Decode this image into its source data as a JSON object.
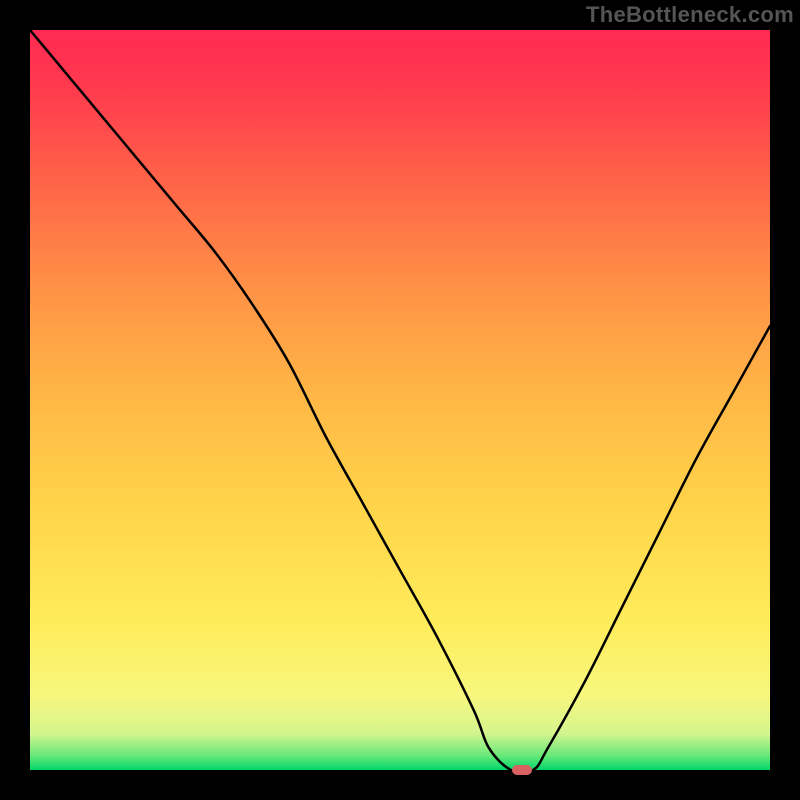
{
  "watermark": "TheBottleneck.com",
  "chart_data": {
    "type": "line",
    "title": "",
    "xlabel": "",
    "ylabel": "",
    "xlim": [
      0,
      100
    ],
    "ylim": [
      0,
      100
    ],
    "x": [
      0,
      5,
      10,
      15,
      20,
      25,
      30,
      35,
      40,
      45,
      50,
      55,
      60,
      62,
      65,
      68,
      70,
      75,
      80,
      85,
      90,
      95,
      100
    ],
    "values": [
      100,
      94,
      88,
      82,
      76,
      70,
      63,
      55,
      45,
      36,
      27,
      18,
      8,
      3,
      0,
      0,
      3,
      12,
      22,
      32,
      42,
      51,
      60
    ],
    "marker": {
      "x": 66.5,
      "y": 0
    },
    "gradient_stops": [
      {
        "offset": 0.0,
        "color": "#00d66a"
      },
      {
        "offset": 0.02,
        "color": "#6be97a"
      },
      {
        "offset": 0.05,
        "color": "#d6f58e"
      },
      {
        "offset": 0.1,
        "color": "#f7f77e"
      },
      {
        "offset": 0.2,
        "color": "#ffec5a"
      },
      {
        "offset": 0.35,
        "color": "#ffd54a"
      },
      {
        "offset": 0.5,
        "color": "#ffb846"
      },
      {
        "offset": 0.65,
        "color": "#ff9246"
      },
      {
        "offset": 0.8,
        "color": "#ff6248"
      },
      {
        "offset": 0.92,
        "color": "#ff3a4e"
      },
      {
        "offset": 1.0,
        "color": "#ff2a52"
      }
    ]
  }
}
